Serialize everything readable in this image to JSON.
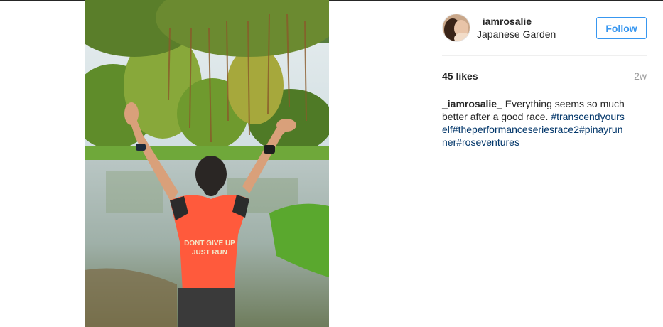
{
  "post": {
    "username": "_iamrosalie_",
    "location": "Japanese Garden",
    "follow_label": "Follow",
    "likes": "45 likes",
    "time_ago": "2w",
    "caption": {
      "username": "_iamrosalie_",
      "text": " Everything seems so much better after a good race.",
      "hashtags": [
        "#transcendyourself",
        "#theperformanceseriesrace2",
        "#pinayrunner",
        "#roseventures"
      ]
    },
    "photo": {
      "shirt_text_line1": "DONT GIVE UP",
      "shirt_text_line2": "JUST RUN"
    }
  },
  "colors": {
    "accent": "#3897f0",
    "hashtag": "#003569",
    "muted": "#999999",
    "text": "#262626",
    "shirt": "#ff5a3c"
  }
}
